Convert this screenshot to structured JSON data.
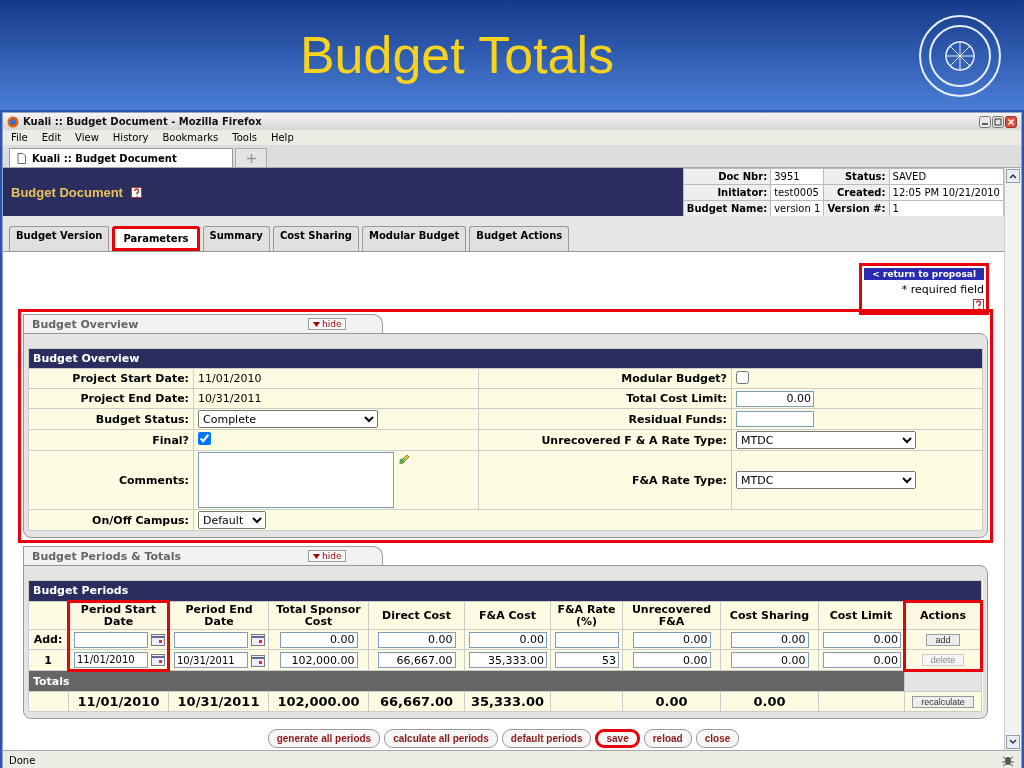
{
  "slide": {
    "title": "Budget Totals"
  },
  "window": {
    "title": "Kuali :: Budget Document - Mozilla Firefox"
  },
  "menu": [
    "File",
    "Edit",
    "View",
    "History",
    "Bookmarks",
    "Tools",
    "Help"
  ],
  "browser_tabs": [
    {
      "label": "Kuali :: Budget Document",
      "selected": true
    }
  ],
  "document": {
    "title": "Budget Document",
    "info": [
      [
        {
          "label": "Doc Nbr:",
          "value": "3951"
        },
        {
          "label": "Status:",
          "value": "SAVED"
        }
      ],
      [
        {
          "label": "Initiator:",
          "value": "test0005"
        },
        {
          "label": "Created:",
          "value": "12:05 PM 10/21/2010"
        }
      ],
      [
        {
          "label": "Budget Name:",
          "value": "version 1"
        },
        {
          "label": "Version #:",
          "value": "1"
        }
      ]
    ]
  },
  "tabs": [
    {
      "label": "Budget Version",
      "selected": false,
      "highlighted": false
    },
    {
      "label": "Parameters",
      "selected": true,
      "highlighted": true
    },
    {
      "label": "Summary",
      "selected": false,
      "highlighted": false
    },
    {
      "label": "Cost Sharing",
      "selected": false,
      "highlighted": false
    },
    {
      "label": "Modular Budget",
      "selected": false,
      "highlighted": false
    },
    {
      "label": "Budget Actions",
      "selected": false,
      "highlighted": false
    }
  ],
  "return_area": {
    "link": "< return to proposal",
    "note": "* required field",
    "highlighted": true
  },
  "overview": {
    "tab_label": "Budget Overview",
    "hide_label": "hide",
    "header": "Budget Overview",
    "highlighted": true,
    "rows": [
      [
        {
          "label": "Project Start Date:",
          "kind": "text",
          "value": "11/01/2010"
        },
        {
          "label": "Modular Budget?",
          "kind": "checkbox",
          "checked": false
        }
      ],
      [
        {
          "label": "Project End Date:",
          "kind": "text",
          "value": "10/31/2011"
        },
        {
          "label": "Total Cost Limit:",
          "kind": "input",
          "value": "0.00"
        }
      ],
      [
        {
          "label": "Budget Status:",
          "kind": "select",
          "value": "Complete"
        },
        {
          "label": "Residual Funds:",
          "kind": "input"
        }
      ],
      [
        {
          "label": "Final?",
          "kind": "checkbox",
          "checked": true
        },
        {
          "label": "Unrecovered F & A Rate Type:",
          "kind": "select",
          "value": "MTDC"
        }
      ],
      [
        {
          "label": "Comments:",
          "kind": "textarea"
        },
        {
          "label": "F&A Rate Type:",
          "kind": "select",
          "value": "MTDC"
        }
      ],
      [
        {
          "label": "On/Off Campus:",
          "kind": "select",
          "value": "Default"
        }
      ]
    ]
  },
  "periods": {
    "tab_label": "Budget Periods & Totals",
    "hide_label": "hide",
    "header": "Budget Periods",
    "columns": [
      {
        "label": "Period Start Date",
        "highlighted": true
      },
      {
        "label": "Period End Date",
        "highlighted": false
      },
      {
        "label": "Total Sponsor Cost",
        "highlighted": false
      },
      {
        "label": "Direct Cost",
        "highlighted": false
      },
      {
        "label": "F&A Cost",
        "highlighted": false
      },
      {
        "label": "F&A Rate (%)",
        "highlighted": false
      },
      {
        "label": "Unrecovered F&A",
        "highlighted": false
      },
      {
        "label": "Cost Sharing",
        "highlighted": false
      },
      {
        "label": "Cost Limit",
        "highlighted": false
      },
      {
        "label": "Actions",
        "highlighted": true
      }
    ],
    "rows": [
      {
        "label": "Add:",
        "cells": [
          {
            "kind": "date"
          },
          {
            "kind": "date"
          },
          {
            "kind": "input",
            "value": "0.00"
          },
          {
            "kind": "input",
            "value": "0.00"
          },
          {
            "kind": "input",
            "value": "0.00"
          },
          {
            "kind": "input"
          },
          {
            "kind": "input",
            "value": "0.00"
          },
          {
            "kind": "input",
            "value": "0.00"
          },
          {
            "kind": "input",
            "value": "0.00"
          }
        ],
        "action": {
          "label": "add",
          "disabled": false
        }
      },
      {
        "label": "1",
        "cells": [
          {
            "kind": "date",
            "value": "11/01/2010"
          },
          {
            "kind": "date",
            "value": "10/31/2011"
          },
          {
            "kind": "input",
            "value": "102,000.00"
          },
          {
            "kind": "input",
            "value": "66,667.00"
          },
          {
            "kind": "input",
            "value": "35,333.00"
          },
          {
            "kind": "input",
            "value": "53"
          },
          {
            "kind": "input",
            "value": "0.00"
          },
          {
            "kind": "input",
            "value": "0.00"
          },
          {
            "kind": "input",
            "value": "0.00"
          }
        ],
        "action": {
          "label": "delete",
          "disabled": true
        }
      }
    ],
    "totals": {
      "label": "Totals",
      "cells": [
        "11/01/2010",
        "10/31/2011",
        "102,000.00",
        "66,667.00",
        "35,333.00",
        null,
        "0.00",
        "0.00",
        null
      ],
      "action": "recalculate"
    }
  },
  "buttons": [
    {
      "label": "generate all periods",
      "highlighted": false
    },
    {
      "label": "calculate all periods",
      "highlighted": false
    },
    {
      "label": "default periods",
      "highlighted": false
    },
    {
      "label": "save",
      "highlighted": true
    },
    {
      "label": "reload",
      "highlighted": false
    },
    {
      "label": "close",
      "highlighted": false
    }
  ],
  "status_bar": "Done"
}
